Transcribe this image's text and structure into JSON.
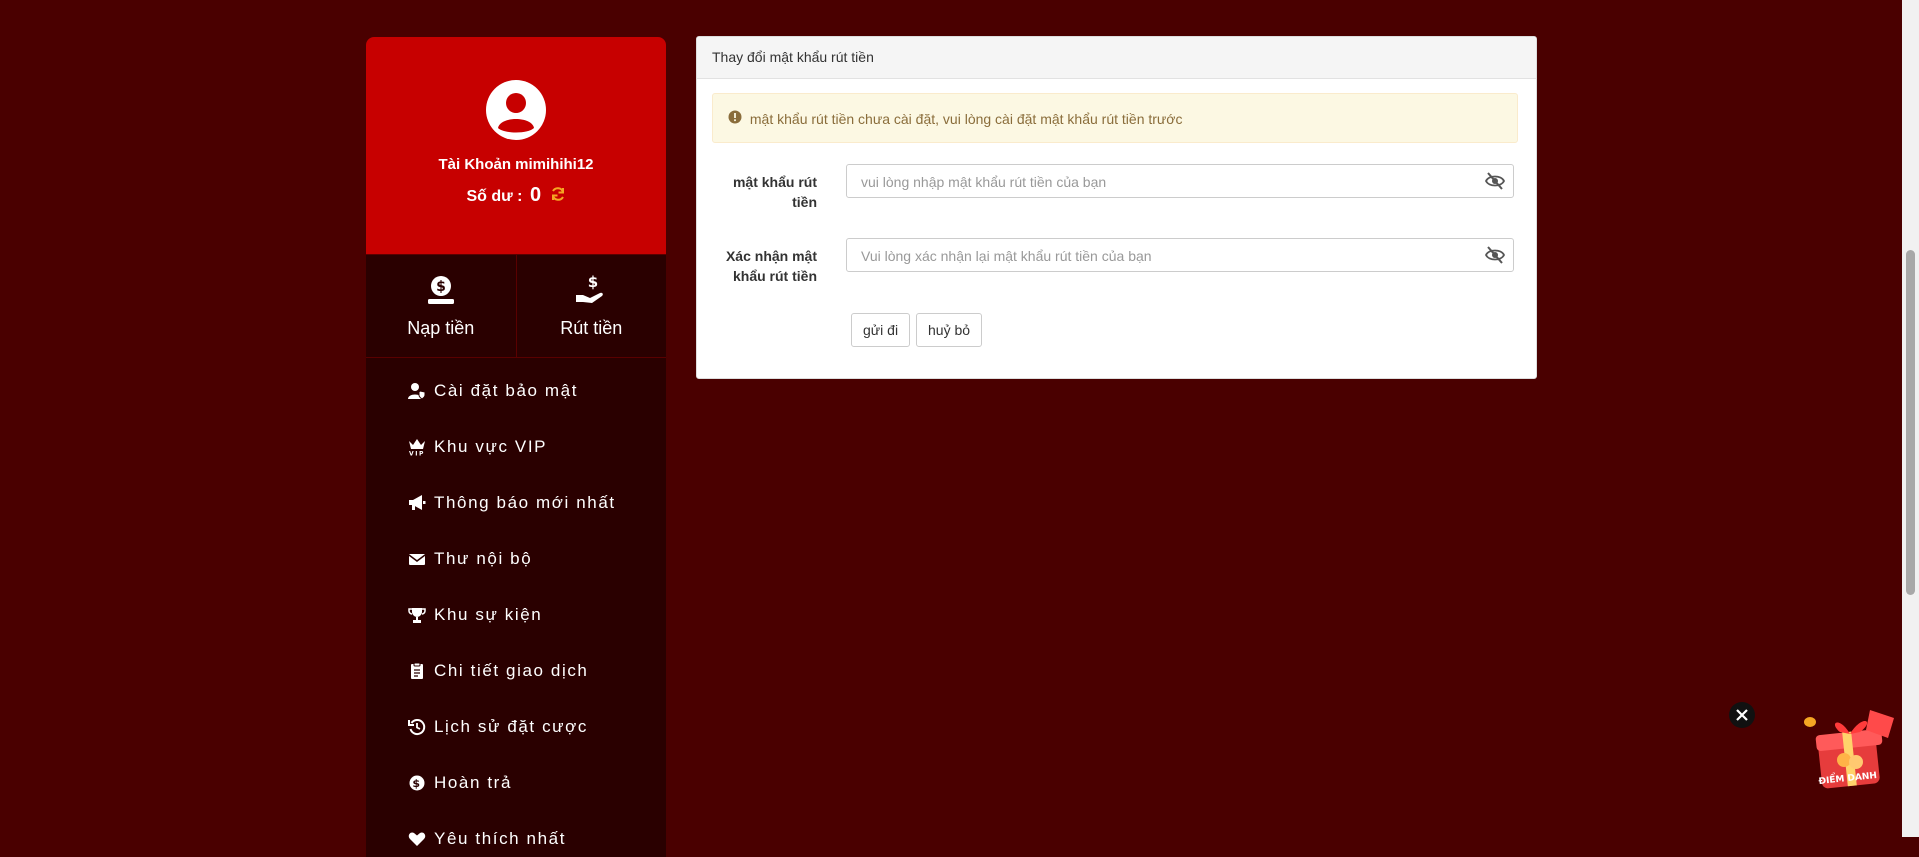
{
  "account": {
    "label": "Tài Khoản mimihihi12",
    "balance_label": "Số dư :",
    "balance_value": "0"
  },
  "quick_actions": [
    {
      "label": "Nạp tiền",
      "icon": "deposit-icon"
    },
    {
      "label": "Rút tiền",
      "icon": "withdraw-icon"
    }
  ],
  "menu": [
    {
      "label": "Cài đặt bảo mật",
      "icon": "user-shield-icon"
    },
    {
      "label": "Khu vực VIP",
      "icon": "crown-vip-icon"
    },
    {
      "label": "Thông báo mới nhất",
      "icon": "megaphone-icon"
    },
    {
      "label": "Thư nội bộ",
      "icon": "envelope-icon"
    },
    {
      "label": "Khu sự kiện",
      "icon": "trophy-icon"
    },
    {
      "label": "Chi tiết giao dịch",
      "icon": "clipboard-icon"
    },
    {
      "label": "Lịch sử đặt cược",
      "icon": "history-icon"
    },
    {
      "label": "Hoàn trả",
      "icon": "dollar-circle-icon"
    },
    {
      "label": "Yêu thích nhất",
      "icon": "heart-icon"
    }
  ],
  "card": {
    "title": "Thay đổi mật khẩu rút tiền",
    "alert": "mật khẩu rút tiền chưa cài đặt, vui lòng cài đặt mật khẩu rút tiền trước",
    "fields": [
      {
        "label": "mật khẩu rút tiền",
        "placeholder": "vui lòng nhập mật khẩu rút tiền của bạn",
        "value": ""
      },
      {
        "label": "Xác nhận mật khẩu rút tiền",
        "placeholder": "Vui lòng xác nhận lại mật khẩu rút tiền của bạn",
        "value": ""
      }
    ],
    "submit_label": "gửi đi",
    "cancel_label": "huỷ bỏ"
  },
  "checkin_widget": {
    "text": "ĐIỂM DANH"
  },
  "colors": {
    "page_bg": "#4a0000",
    "profile_bg": "#c70000",
    "sidebar_bg": "#2a0000",
    "alert_bg": "#fcf8e3",
    "alert_text": "#8a6d3b",
    "refresh_accent": "#f5a623"
  }
}
